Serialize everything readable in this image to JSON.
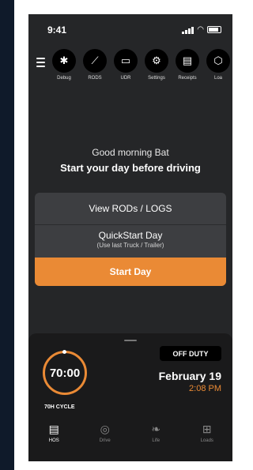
{
  "status": {
    "time": "9:41"
  },
  "quick_actions": [
    {
      "label": "Debug",
      "icon": "bug-icon",
      "glyph": "✱"
    },
    {
      "label": "RODS",
      "icon": "chart-icon",
      "glyph": "⟋"
    },
    {
      "label": "UDR",
      "icon": "folder-icon",
      "glyph": "▭"
    },
    {
      "label": "Settings",
      "icon": "settings-icon",
      "glyph": "⚙"
    },
    {
      "label": "Receipts",
      "icon": "receipt-icon",
      "glyph": "▤"
    },
    {
      "label": "Loa",
      "icon": "box-icon",
      "glyph": "⬡"
    }
  ],
  "greeting": "Good morning Bat",
  "headline": "Start your day before driving",
  "buttons": {
    "view_rods": "View RODs / LOGS",
    "quickstart_title": "QuickStart Day",
    "quickstart_sub": "(Use last Truck / Trailer)",
    "start_day": "Start Day"
  },
  "summary": {
    "cycle_value": "70:00",
    "cycle_label": "70H CYCLE",
    "duty_status": "OFF DUTY",
    "date": "February 19",
    "time": "2:08 PM"
  },
  "tabs": [
    {
      "label": "HOS",
      "icon": "hos-icon",
      "glyph": "▤",
      "active": true
    },
    {
      "label": "Drive",
      "icon": "drive-icon",
      "glyph": "◎",
      "active": false
    },
    {
      "label": "Life",
      "icon": "life-icon",
      "glyph": "❧",
      "active": false
    },
    {
      "label": "Loads",
      "icon": "loads-icon",
      "glyph": "⊞",
      "active": false
    }
  ],
  "colors": {
    "accent": "#ea8a35",
    "background": "#252628"
  }
}
